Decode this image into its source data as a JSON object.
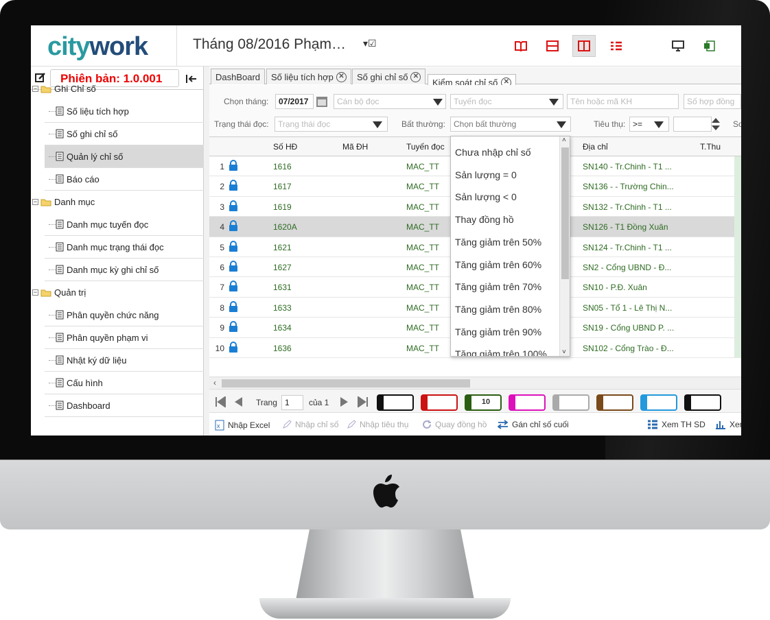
{
  "app": {
    "logo_a": "city",
    "logo_b": "work",
    "version": "Phiên bản: 1.0.001",
    "title": "Tháng 08/2016 Phạm…"
  },
  "tabs": [
    {
      "label": "DashBoard",
      "closable": false
    },
    {
      "label": "Số liệu tích hợp",
      "closable": true
    },
    {
      "label": "Số ghi chỉ số",
      "closable": true
    },
    {
      "label": "Kiểm soát chỉ số",
      "closable": true,
      "active": true
    }
  ],
  "tree": [
    {
      "label": "Ghi Chỉ số",
      "type": "folder"
    },
    {
      "label": "Số liệu tích hợp",
      "type": "doc"
    },
    {
      "label": "Số ghi chỉ số",
      "type": "doc"
    },
    {
      "label": "Quản lý chỉ số",
      "type": "doc",
      "selected": true
    },
    {
      "label": "Báo cáo",
      "type": "doc"
    },
    {
      "label": "Danh mục",
      "type": "folder"
    },
    {
      "label": "Danh mục tuyến đọc",
      "type": "doc"
    },
    {
      "label": "Danh mục trạng thái đọc",
      "type": "doc"
    },
    {
      "label": "Danh mục kỳ ghi chỉ số",
      "type": "doc"
    },
    {
      "label": "Quản trị",
      "type": "folder"
    },
    {
      "label": "Phân quyền chức năng",
      "type": "doc"
    },
    {
      "label": "Phân quyền phạm vi",
      "type": "doc"
    },
    {
      "label": "Nhật ký dữ liệu",
      "type": "doc"
    },
    {
      "label": "Cấu hình",
      "type": "doc"
    },
    {
      "label": "Dashboard",
      "type": "doc"
    }
  ],
  "filters": {
    "month_label": "Chọn tháng:",
    "month_value": "07/2017",
    "officer_placeholder": "Cán bộ đọc",
    "route_placeholder": "Tuyến đọc",
    "customer_placeholder": "Tên hoặc mã KH",
    "contract_placeholder": "Số hợp đồng",
    "status_label": "Trạng thái đọc:",
    "status_placeholder": "Trạng thái đọc",
    "abnormal_label": "Bất thường:",
    "abnormal_placeholder": "Chọn bất thường",
    "consumption_label": "Tiêu thụ:",
    "consumption_op": ">=",
    "cutoff_label": "Sơ"
  },
  "grid": {
    "columns": [
      "Số HĐ",
      "Mã ĐH",
      "Tuyến đọc",
      "Địa chỉ",
      "T.Thu"
    ],
    "rows": [
      {
        "n": "1",
        "contract": "1616",
        "route": "MAC_TT",
        "address": "SN140 - Tr.Chinh - T1 ..."
      },
      {
        "n": "2",
        "contract": "1617",
        "route": "MAC_TT",
        "address": "SN136 - - Trường Chin..."
      },
      {
        "n": "3",
        "contract": "1619",
        "route": "MAC_TT",
        "address": "SN132 - Tr.Chinh - T1 ..."
      },
      {
        "n": "4",
        "contract": "1620A",
        "route": "MAC_TT",
        "address": "SN126 - T1 Đồng Xuân",
        "selected": true
      },
      {
        "n": "5",
        "contract": "1621",
        "route": "MAC_TT",
        "address": "SN124 - Tr.Chinh - T1 ..."
      },
      {
        "n": "6",
        "contract": "1627",
        "route": "MAC_TT",
        "address": "SN2 - Cổng UBND - Đ..."
      },
      {
        "n": "7",
        "contract": "1631",
        "route": "MAC_TT",
        "address": "SN10 - P.Đ. Xuân"
      },
      {
        "n": "8",
        "contract": "1633",
        "route": "MAC_TT",
        "address": "SN05 - Tổ 1 - Lê Thị N..."
      },
      {
        "n": "9",
        "contract": "1634",
        "route": "MAC_TT",
        "address": "SN19 - Cổng UBND P. ..."
      },
      {
        "n": "10",
        "contract": "1636",
        "route": "MAC_TT",
        "address": "SN102 - Cổng Trào - Đ..."
      }
    ]
  },
  "dropdown": {
    "items": [
      "Chưa nhập chỉ số",
      "Sản lượng = 0",
      "Sản lượng < 0",
      "Thay đồng hồ",
      "Tăng giảm trên 50%",
      "Tăng giảm trên 60%",
      "Tăng giảm trên 70%",
      "Tăng giảm trên 80%",
      "Tăng giảm trên 90%",
      "Tăng giảm trên 100%"
    ]
  },
  "pager": {
    "page_label": "Trang",
    "page_value": "1",
    "of_label": "của 1",
    "legend": [
      {
        "color": "#111111",
        "text": ""
      },
      {
        "color": "#cc1111",
        "text": ""
      },
      {
        "color": "#2a5d12",
        "text": "10"
      },
      {
        "color": "#dd11bb",
        "text": ""
      },
      {
        "color": "#aaaaaa",
        "text": ""
      },
      {
        "color": "#7a4a1a",
        "text": ""
      },
      {
        "color": "#2299dd",
        "text": ""
      },
      {
        "color": "#111111",
        "text": ""
      }
    ]
  },
  "actions": {
    "import_excel": "Nhập Excel",
    "enter_index": "Nhập chỉ số",
    "enter_consumption": "Nhập tiêu thụ",
    "rotate_meter": "Quay đồng hồ",
    "assign_last": "Gán chỉ số cuối",
    "view_th_sd": "Xem TH SD",
    "view_more": "Xem"
  },
  "colors": {
    "accent": "#2a9aa0",
    "brand_dark": "#234d7a",
    "version_red": "#e00000",
    "row_green": "#2e6b22"
  }
}
